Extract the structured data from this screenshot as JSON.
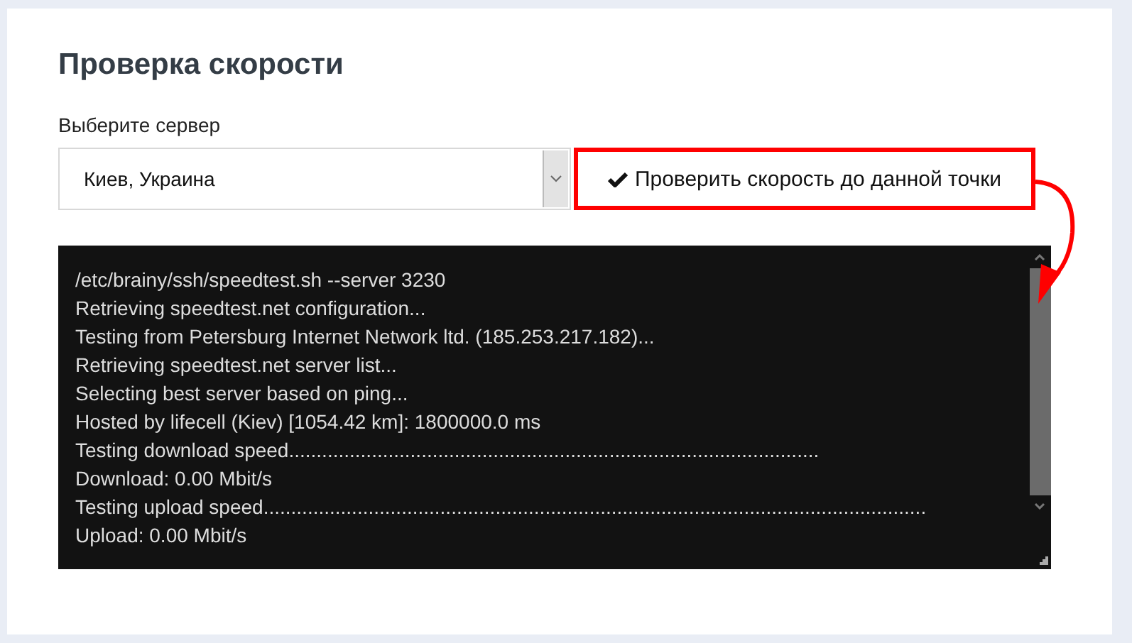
{
  "title": "Проверка скорости",
  "server_label": "Выберите сервер",
  "server_select": {
    "value": "Киев, Украина"
  },
  "check_button": {
    "label": "Проверить скорость до данной точки"
  },
  "terminal": {
    "lines": [
      "/etc/brainy/ssh/speedtest.sh --server 3230",
      "Retrieving speedtest.net configuration...",
      "Testing from Petersburg Internet Network ltd. (185.253.217.182)...",
      "Retrieving speedtest.net server list...",
      "Selecting best server based on ping...",
      "Hosted by lifecell (Kiev) [1054.42 km]: 1800000.0 ms",
      "Testing download speed................................................................................................",
      "Download: 0.00 Mbit/s",
      "Testing upload speed........................................................................................................................",
      "Upload: 0.00 Mbit/s"
    ]
  }
}
